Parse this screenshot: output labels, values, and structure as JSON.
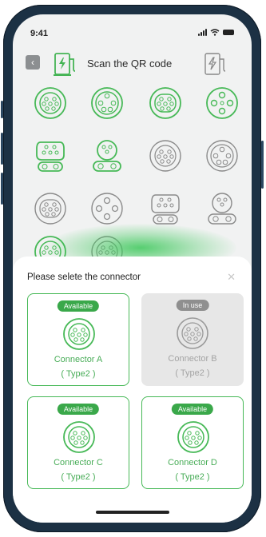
{
  "status_bar": {
    "time": "9:41"
  },
  "header": {
    "title": "Scan the QR code",
    "back_icon": "chevron-left-icon"
  },
  "connector_grid_icons": [
    "type2-icon",
    "ccs-icon",
    "type2-icon",
    "chademo-icon",
    "ccs2-icon",
    "gbt-icon",
    "type2-icon",
    "chademo-icon",
    "type2-icon",
    "chademo-icon",
    "ccs2-icon",
    "gbt-icon",
    "type2-icon",
    "type2-icon"
  ],
  "sheet": {
    "title": "Please selete the connector",
    "close_icon": "close-icon",
    "connectors": [
      {
        "status": "Available",
        "name": "Connector A",
        "type": "( Type2 )"
      },
      {
        "status": "In use",
        "name": "Connector B",
        "type": "( Type2 )"
      },
      {
        "status": "Available",
        "name": "Connector C",
        "type": "( Type2 )"
      },
      {
        "status": "Available",
        "name": "Connector D",
        "type": "( Type2 )"
      }
    ]
  },
  "colors": {
    "accent": "#47b957",
    "in_use": "#8f8f8f",
    "frame": "#1c3144"
  }
}
